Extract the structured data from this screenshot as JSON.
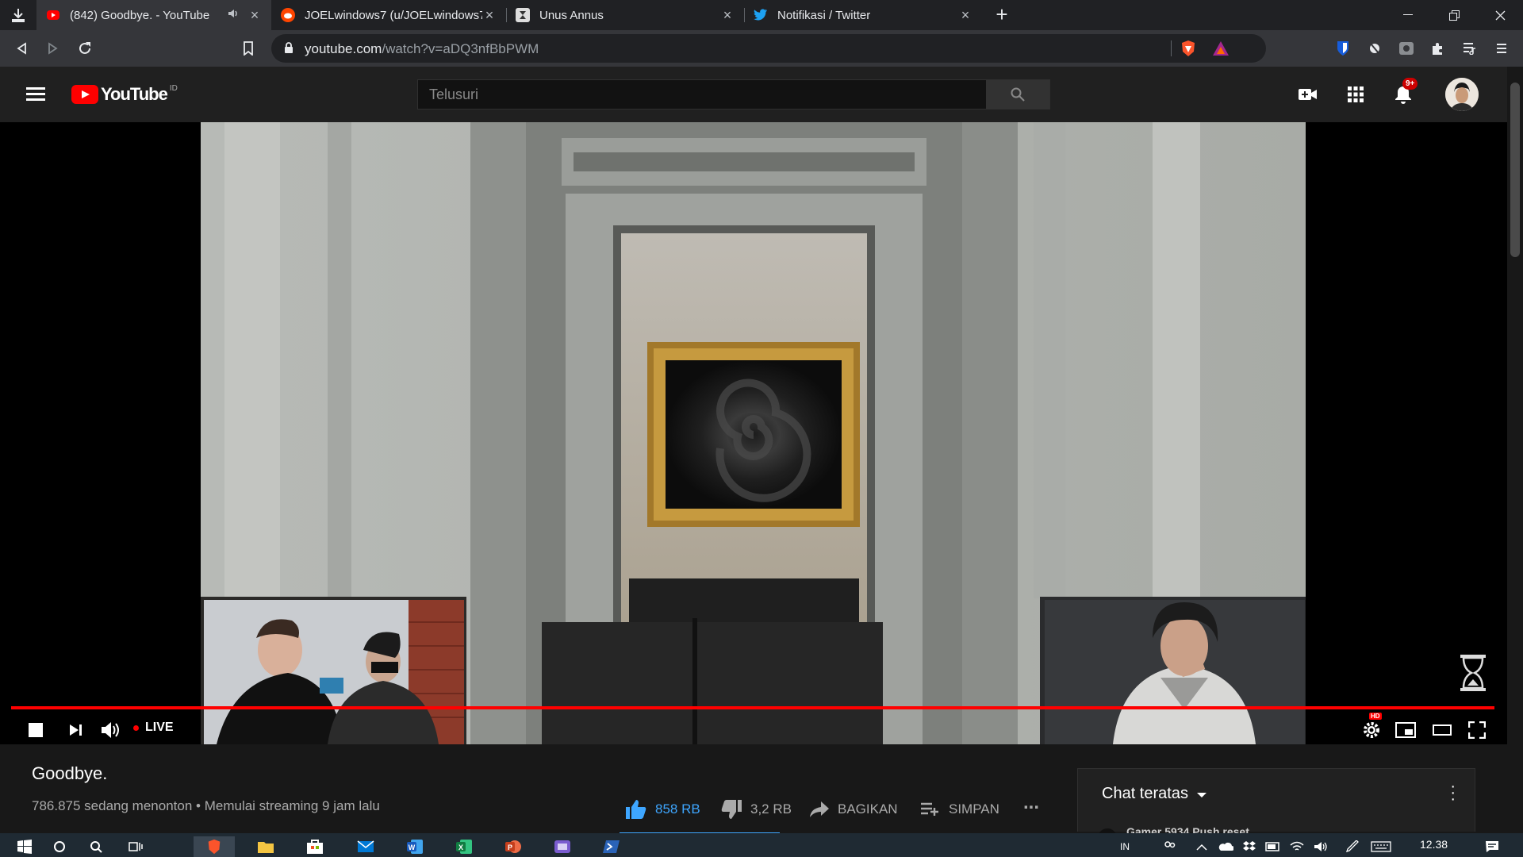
{
  "browser": {
    "tabs": [
      {
        "title": "(842) Goodbye. - YouTube",
        "favicon": "youtube-icon",
        "active": true,
        "muted_icon": "speaker-icon"
      },
      {
        "title": "JOELwindows7 (u/JOELwindows7) -",
        "favicon": "reddit-icon",
        "active": false
      },
      {
        "title": "Unus Annus",
        "favicon": "unus-annus-icon",
        "active": false
      },
      {
        "title": "Notifikasi / Twitter",
        "favicon": "twitter-icon",
        "active": false
      }
    ],
    "url": {
      "domain": "youtube.com",
      "path": "/watch?v=aDQ3nfBbPWM"
    }
  },
  "youtube": {
    "logo_text": "YouTube",
    "region": "ID",
    "search_placeholder": "Telusuri",
    "notification_badge": "9+",
    "player": {
      "live_label": "LIVE",
      "hd_badge": "HD"
    },
    "video": {
      "title": "Goodbye.",
      "viewers": "786.875 sedang menonton",
      "separator": "•",
      "started": "Memulai streaming 9 jam lalu",
      "likes": "858 RB",
      "dislikes": "3,2 RB",
      "share_label": "BAGIKAN",
      "save_label": "SIMPAN",
      "more_label": "..."
    },
    "chat": {
      "mode_label": "Chat teratas",
      "peek_text": "Gamer 5934  Push reset"
    }
  },
  "taskbar": {
    "language": "IN",
    "time": "12.38"
  },
  "colors": {
    "accent": "#3ea6ff",
    "brand_red": "#ff0000",
    "background": "#181818"
  }
}
